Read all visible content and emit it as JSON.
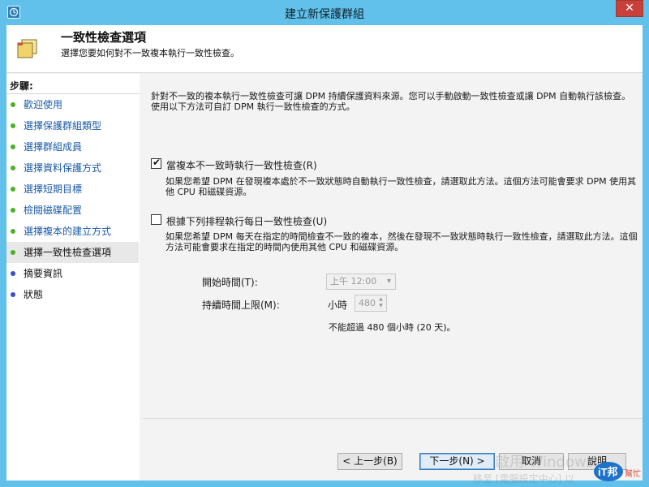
{
  "window": {
    "title": "建立新保護群組",
    "close_glyph": "✕"
  },
  "header": {
    "title": "一致性檢查選項",
    "subtitle": "選擇您要如何對不一致複本執行一致性檢查。"
  },
  "sidebar": {
    "steps_label": "步驟:",
    "items": [
      {
        "label": "歡迎使用",
        "state": "done"
      },
      {
        "label": "選擇保護群組類型",
        "state": "done"
      },
      {
        "label": "選擇群組成員",
        "state": "done"
      },
      {
        "label": "選擇資料保護方式",
        "state": "done"
      },
      {
        "label": "選擇短期目標",
        "state": "done"
      },
      {
        "label": "檢閱磁碟配置",
        "state": "done"
      },
      {
        "label": "選擇複本的建立方式",
        "state": "done"
      },
      {
        "label": "選擇一致性檢查選項",
        "state": "current"
      },
      {
        "label": "摘要資訊",
        "state": "todo"
      },
      {
        "label": "狀態",
        "state": "todo"
      }
    ]
  },
  "main": {
    "intro": "針對不一致的複本執行一致性檢查可讓 DPM 持續保護資料來源。您可以手動啟動一致性檢查或讓 DPM 自動執行該檢查。使用以下方法可自訂 DPM 執行一致性檢查的方式。",
    "option1": {
      "checked": true,
      "label": "當複本不一致時執行一致性檢查(R)",
      "description": "如果您希望 DPM 在發現複本處於不一致狀態時自動執行一致性檢查，請選取此方法。這個方法可能會要求 DPM 使用其他 CPU 和磁碟資源。"
    },
    "option2": {
      "checked": false,
      "label": "根據下列排程執行每日一致性檢查(U)",
      "description": "如果您希望 DPM 每天在指定的時間檢查不一致的複本，然後在發現不一致狀態時執行一致性檢查，請選取此方法。這個方法可能會要求在指定的時間內使用其他 CPU 和磁碟資源。"
    },
    "start_time": {
      "label": "開始時間(T):",
      "value": "上午 12:00"
    },
    "duration": {
      "label": "持續時間上限(M):",
      "unit": "小時",
      "value": "480"
    },
    "note": "不能超過 480 個小時 (20 天)。"
  },
  "buttons": {
    "back": "< 上一步(B)",
    "next": "下一步(N) >",
    "cancel": "取消",
    "help": "說明"
  },
  "watermark": {
    "line1": "啟用 Windows",
    "line2": "移至 [電腦設定中心] 以"
  },
  "brand": {
    "text": "iT邦",
    "subtext": "幫忙"
  },
  "colors": {
    "titlebar": "#61c1ea",
    "done_dot": "#4cb02a",
    "todo_dot": "#3a4fc4",
    "link": "#1b5aa6"
  }
}
